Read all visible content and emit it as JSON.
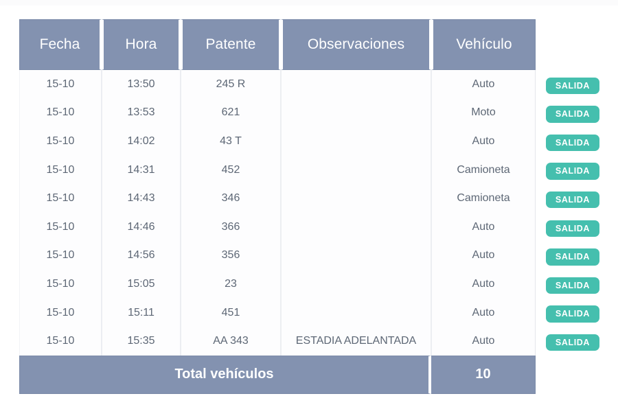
{
  "table": {
    "columns": [
      {
        "key": "fecha",
        "label": "Fecha"
      },
      {
        "key": "hora",
        "label": "Hora"
      },
      {
        "key": "patente",
        "label": "Patente"
      },
      {
        "key": "observaciones",
        "label": "Observaciones"
      },
      {
        "key": "vehiculo",
        "label": "Vehículo"
      }
    ],
    "rows": [
      {
        "fecha": "15-10",
        "hora": "13:50",
        "patente": "245 R",
        "observaciones": "",
        "vehiculo": "Auto",
        "estado": "SALIDA"
      },
      {
        "fecha": "15-10",
        "hora": "13:53",
        "patente": "621",
        "observaciones": "",
        "vehiculo": "Moto",
        "estado": "SALIDA"
      },
      {
        "fecha": "15-10",
        "hora": "14:02",
        "patente": "43 T",
        "observaciones": "",
        "vehiculo": "Auto",
        "estado": "SALIDA"
      },
      {
        "fecha": "15-10",
        "hora": "14:31",
        "patente": "452",
        "observaciones": "",
        "vehiculo": "Camioneta",
        "estado": "SALIDA"
      },
      {
        "fecha": "15-10",
        "hora": "14:43",
        "patente": "346",
        "observaciones": "",
        "vehiculo": "Camioneta",
        "estado": "SALIDA"
      },
      {
        "fecha": "15-10",
        "hora": "14:46",
        "patente": "366",
        "observaciones": "",
        "vehiculo": "Auto",
        "estado": "SALIDA"
      },
      {
        "fecha": "15-10",
        "hora": "14:56",
        "patente": "356",
        "observaciones": "",
        "vehiculo": "Auto",
        "estado": "SALIDA"
      },
      {
        "fecha": "15-10",
        "hora": "15:05",
        "patente": "23",
        "observaciones": "",
        "vehiculo": "Auto",
        "estado": "SALIDA"
      },
      {
        "fecha": "15-10",
        "hora": "15:11",
        "patente": "451",
        "observaciones": "",
        "vehiculo": "Auto",
        "estado": "SALIDA"
      },
      {
        "fecha": "15-10",
        "hora": "15:35",
        "patente": "AA 343",
        "observaciones": "ESTADIA ADELANTADA",
        "vehiculo": "Auto",
        "estado": "SALIDA"
      }
    ],
    "footer": {
      "label": "Total vehículos",
      "value": "10"
    }
  },
  "colors": {
    "header_background": "#8392b0",
    "header_text": "#ffffff",
    "body_text": "#5d6775",
    "badge_background": "#45bfae",
    "badge_text": "#ffffff",
    "page_background": "#ffffff",
    "cell_border": "#eceef2"
  }
}
